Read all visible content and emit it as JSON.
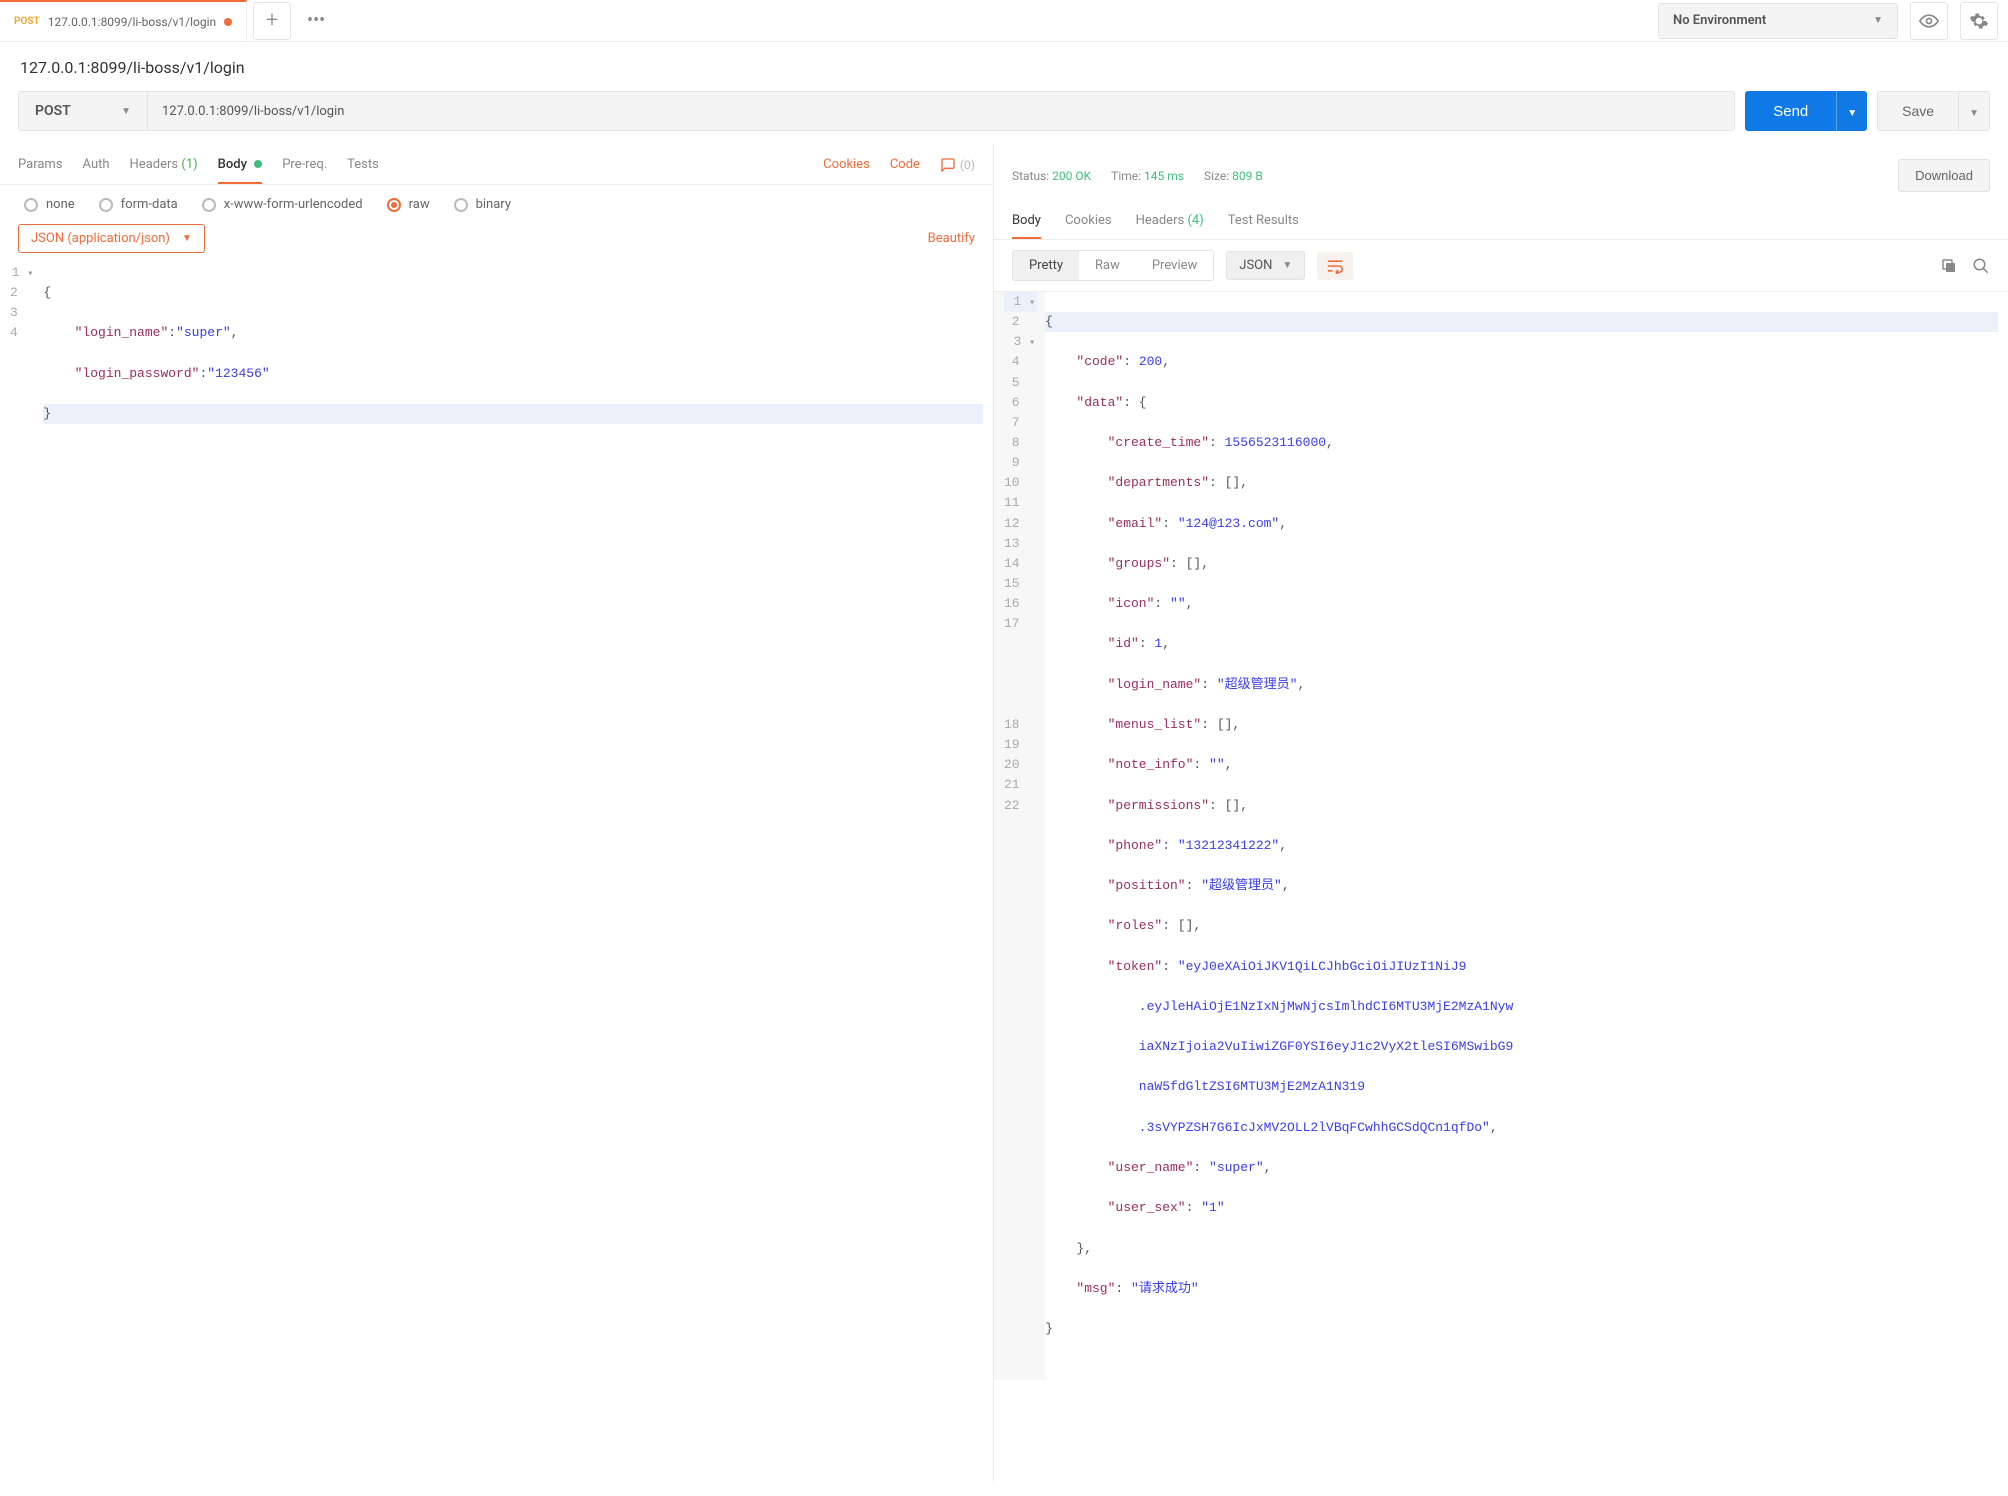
{
  "tab": {
    "method": "POST",
    "url": "127.0.0.1:8099/li-boss/v1/login"
  },
  "env": {
    "label": "No Environment"
  },
  "title": "127.0.0.1:8099/li-boss/v1/login",
  "request": {
    "method": "POST",
    "url": "127.0.0.1:8099/li-boss/v1/login",
    "send": "Send",
    "save": "Save"
  },
  "req_tabs": {
    "params": "Params",
    "auth": "Auth",
    "headers": "Headers",
    "headers_count": "(1)",
    "body": "Body",
    "prereq": "Pre-req.",
    "tests": "Tests",
    "cookies": "Cookies",
    "code": "Code",
    "comments": "(0)"
  },
  "body_types": {
    "none": "none",
    "form_data": "form-data",
    "urlencoded": "x-www-form-urlencoded",
    "raw": "raw",
    "binary": "binary"
  },
  "json_dd": "JSON (application/json)",
  "beautify": "Beautify",
  "req_body": {
    "l1": "{",
    "l2_k": "\"login_name\"",
    "l2_v": "\"super\"",
    "l3_k": "\"login_password\"",
    "l3_v": "\"123456\"",
    "l4": "}"
  },
  "status": {
    "status_label": "Status:",
    "status_val": "200 OK",
    "time_label": "Time:",
    "time_val": "145 ms",
    "size_label": "Size:",
    "size_val": "809 B",
    "download": "Download"
  },
  "resp_tabs": {
    "body": "Body",
    "cookies": "Cookies",
    "headers": "Headers",
    "headers_count": "(4)",
    "tests": "Test Results"
  },
  "resp_toolbar": {
    "pretty": "Pretty",
    "raw": "Raw",
    "preview": "Preview",
    "fmt": "JSON"
  },
  "response": {
    "code_k": "\"code\"",
    "code_v": "200",
    "data_k": "\"data\"",
    "create_time_k": "\"create_time\"",
    "create_time_v": "1556523116000",
    "departments_k": "\"departments\"",
    "email_k": "\"email\"",
    "email_v": "\"124@123.com\"",
    "groups_k": "\"groups\"",
    "icon_k": "\"icon\"",
    "icon_v": "\"\"",
    "id_k": "\"id\"",
    "id_v": "1",
    "login_name_k": "\"login_name\"",
    "login_name_v": "\"超级管理员\"",
    "menus_list_k": "\"menus_list\"",
    "note_info_k": "\"note_info\"",
    "note_info_v": "\"\"",
    "permissions_k": "\"permissions\"",
    "phone_k": "\"phone\"",
    "phone_v": "\"13212341222\"",
    "position_k": "\"position\"",
    "position_v": "\"超级管理员\"",
    "roles_k": "\"roles\"",
    "token_k": "\"token\"",
    "token_v1": "\"eyJ0eXAiOiJKV1QiLCJhbGciOiJIUzI1NiJ9",
    "token_v2": ".eyJleHAiOjE1NzIxNjMwNjcsImlhdCI6MTU3MjE2MzA1Nyw",
    "token_v3": "iaXNzIjoia2VuIiwiZGF0YSI6eyJ1c2VyX2tleSI6MSwibG9",
    "token_v4": "naW5fdGltZSI6MTU3MjE2MzA1N319",
    "token_v5": ".3sVYPZSH7G6IcJxMV2OLL2lVBqFCwhhGCSdQCn1qfDo\"",
    "user_name_k": "\"user_name\"",
    "user_name_v": "\"super\"",
    "user_sex_k": "\"user_sex\"",
    "user_sex_v": "\"1\"",
    "msg_k": "\"msg\"",
    "msg_v": "\"请求成功\""
  }
}
